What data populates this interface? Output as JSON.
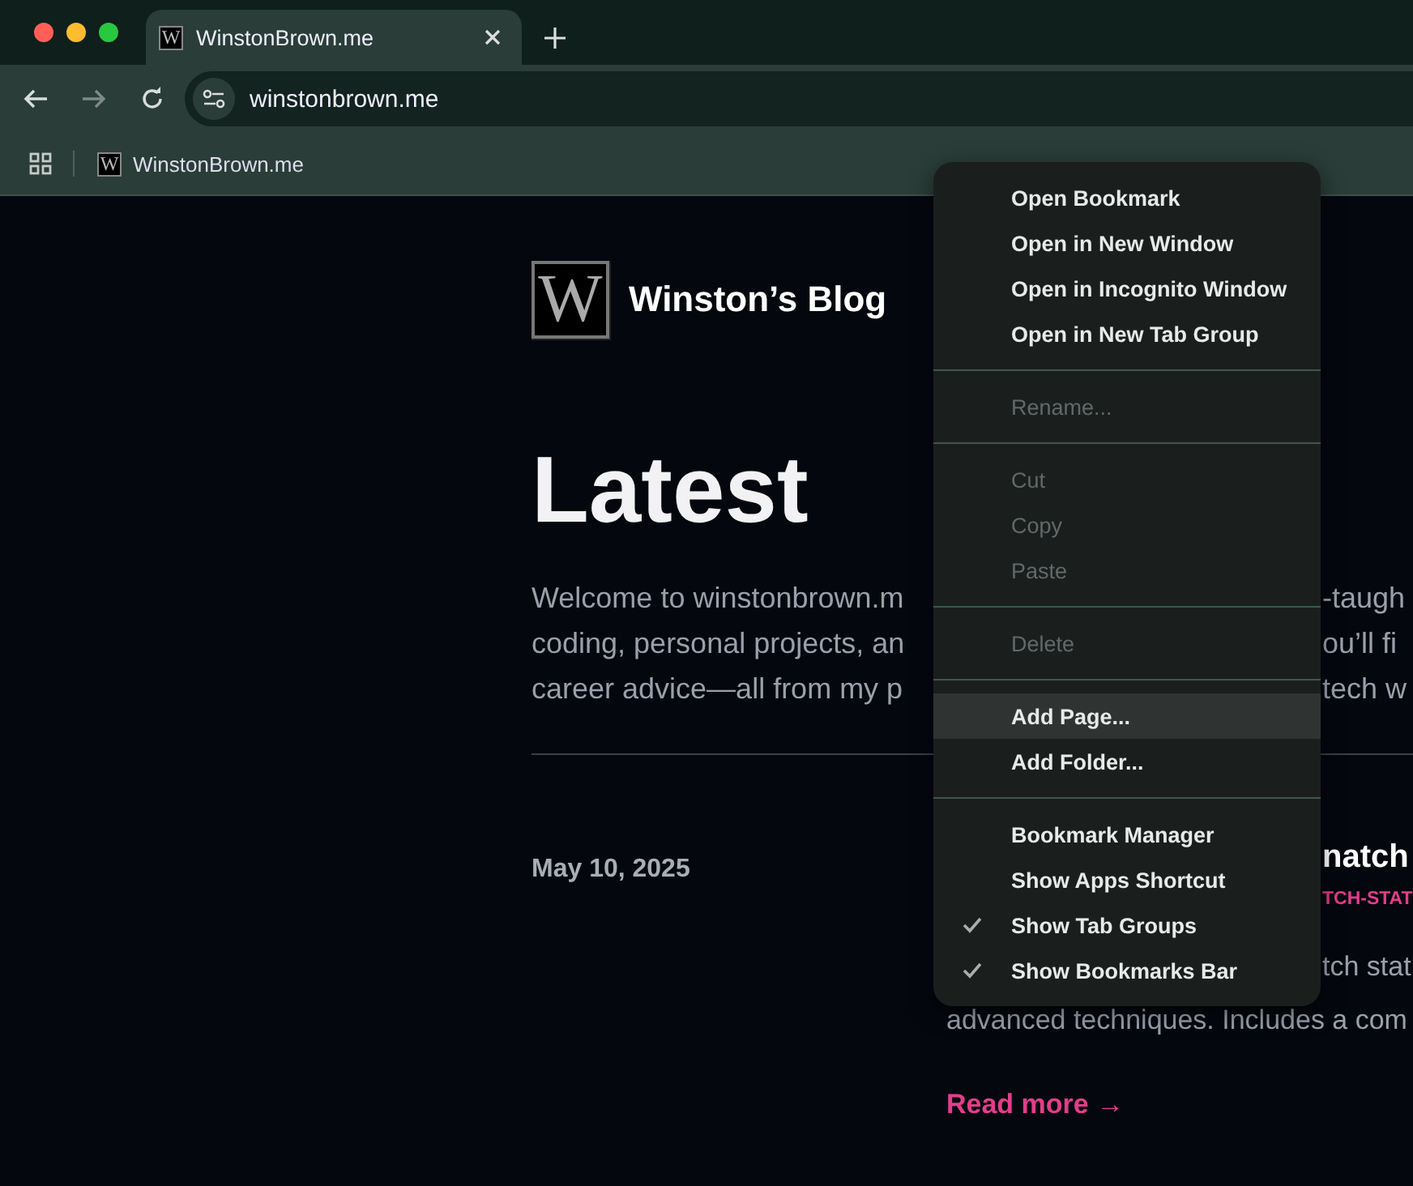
{
  "tab": {
    "title": "WinstonBrown.me",
    "favicon": "W",
    "selected": true
  },
  "toolbar": {
    "address": "winstonbrown.me",
    "forward_disabled": true
  },
  "bookmarks": [
    {
      "label": "WinstonBrown.me",
      "favicon": "W"
    }
  ],
  "site": {
    "logo": "W",
    "title": "Winston’s Blog",
    "heading": "Latest",
    "intro_left": [
      "Welcome to winstonbrown.m",
      "coding, personal projects, an",
      "career advice—all from my p"
    ],
    "intro_right": [
      "-taugh",
      "ou’ll fi",
      "tech w"
    ],
    "post": {
      "date": "May 10, 2025",
      "title": "natch",
      "tag": "TCH-STAT",
      "excerpt_right": "tch stat",
      "excerpt_below": "advanced techniques. Includes a com",
      "read_more": "Read more →"
    }
  },
  "menu": {
    "groups": [
      [
        {
          "label": "Open Bookmark",
          "disabled": false,
          "checked": false,
          "selected": false
        },
        {
          "label": "Open in New Window",
          "disabled": false,
          "checked": false,
          "selected": false
        },
        {
          "label": "Open in Incognito Window",
          "disabled": false,
          "checked": false,
          "selected": false
        },
        {
          "label": "Open in New Tab Group",
          "disabled": false,
          "checked": false,
          "selected": false
        }
      ],
      [
        {
          "label": "Rename...",
          "disabled": true,
          "checked": false,
          "selected": false
        }
      ],
      [
        {
          "label": "Cut",
          "disabled": true,
          "checked": false,
          "selected": false
        },
        {
          "label": "Copy",
          "disabled": true,
          "checked": false,
          "selected": false
        },
        {
          "label": "Paste",
          "disabled": true,
          "checked": false,
          "selected": false
        }
      ],
      [
        {
          "label": "Delete",
          "disabled": true,
          "checked": false,
          "selected": false
        }
      ],
      [
        {
          "label": "Add Page...",
          "disabled": false,
          "checked": false,
          "selected": true
        },
        {
          "label": "Add Folder...",
          "disabled": false,
          "checked": false,
          "selected": false
        }
      ],
      [
        {
          "label": "Bookmark Manager",
          "disabled": false,
          "checked": false,
          "selected": false
        },
        {
          "label": "Show Apps Shortcut",
          "disabled": false,
          "checked": false,
          "selected": false
        },
        {
          "label": "Show Tab Groups",
          "disabled": false,
          "checked": true,
          "selected": false
        },
        {
          "label": "Show Bookmarks Bar",
          "disabled": false,
          "checked": true,
          "selected": false
        }
      ]
    ]
  }
}
